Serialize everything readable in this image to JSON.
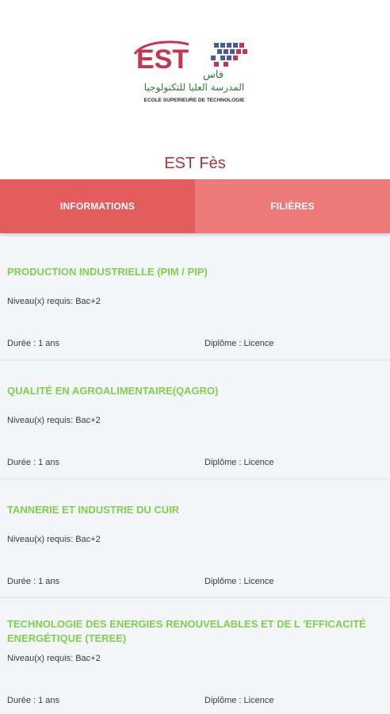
{
  "header": {
    "logo_wordmark": "EST",
    "logo_arabic_top": "فاس",
    "logo_arabic": "المدرسة العليا للتكنولوجيا",
    "logo_subtitle": "ECOLE SUPERIEURE DE TECHNOLOGIE",
    "school_name": "EST Fès"
  },
  "tabs": [
    {
      "label": "INFORMATIONS",
      "active": true
    },
    {
      "label": "FILIÈRES",
      "active": false
    }
  ],
  "programs": [
    {
      "title": "PRODUCTION INDUSTRIELLE (PIM / PIP)",
      "level": "Niveau(x) requis: Bac+2",
      "duration": "Durée : 1 ans",
      "diploma": "Diplôme : Licence"
    },
    {
      "title": "QUALITÉ EN AGROALIMENTAIRE(QAGRO)",
      "level": "Niveau(x) requis: Bac+2",
      "duration": "Durée : 1 ans",
      "diploma": "Diplôme : Licence"
    },
    {
      "title": "TANNERIE ET INDUSTRIE DU CUIR",
      "level": "Niveau(x) requis: Bac+2",
      "duration": "Durée : 1 ans",
      "diploma": "Diplôme : Licence"
    },
    {
      "title": "TECHNOLOGIE DES ENERGIES RENOUVELABLES ET DE L 'EFFICACITÉ ENERGÉTIQUE (TEREE)",
      "level": "Niveau(x) requis: Bac+2",
      "duration": "Durée : 1 ans",
      "diploma": "Diplôme : Licence"
    }
  ],
  "colors": {
    "accent": "#e35d5f",
    "tab_inactive": "#ec7a79",
    "title_green": "#7dd24a",
    "school_name": "#a8363f"
  }
}
